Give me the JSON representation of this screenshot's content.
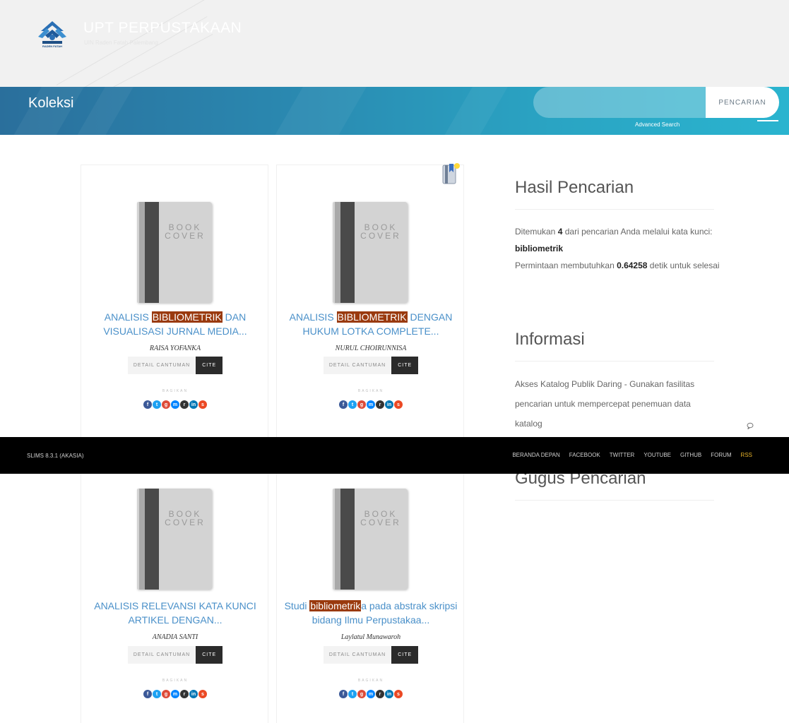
{
  "header": {
    "site_title": "UPT PERPUSTAKAAN",
    "site_subtitle": "UIN Raden Fatah Palembang",
    "logo_text": "RADEN FATAH"
  },
  "banner": {
    "page_title": "Koleksi",
    "search_placeholder": "",
    "search_button": "PENCARIAN",
    "advanced_search": "Advanced Search"
  },
  "books": [
    {
      "cover_text": "BOOK COVER",
      "title_pre": "ANALISIS ",
      "title_hl": "BIBLIOMETRIK",
      "title_post": " DAN VISUALISASI JURNAL MEDIA...",
      "author": "RAISA YOFANKA",
      "detail_label": "DETAIL CANTUMAN",
      "cite_label": "CITE",
      "share_label": "BAGIKAN"
    },
    {
      "cover_text": "BOOK COVER",
      "title_pre": "ANALISIS ",
      "title_hl": "BIBLIOMETRIK",
      "title_post": " DENGAN HUKUM LOTKA COMPLETE...",
      "author": "NURUL CHOIRUNNISA",
      "detail_label": "DETAIL CANTUMAN",
      "cite_label": "CITE",
      "share_label": "BAGIKAN"
    },
    {
      "cover_text": "BOOK COVER",
      "title_pre": "ANALISIS RELEVANSI KATA KUNCI ARTIKEL DENGAN...",
      "title_hl": "",
      "title_post": "",
      "author": "ANADIA SANTI",
      "detail_label": "DETAIL CANTUMAN",
      "cite_label": "CITE",
      "share_label": "BAGIKAN"
    },
    {
      "cover_text": "BOOK COVER",
      "title_pre": "Studi ",
      "title_hl": "bibliometrik",
      "title_post": "a pada abstrak skripsi bidang Ilmu Perpustakaa...",
      "author": "Laylatul Munawaroh",
      "detail_label": "DETAIL CANTUMAN",
      "cite_label": "CITE",
      "share_label": "BAGIKAN"
    }
  ],
  "share_icons": [
    {
      "name": "facebook-icon",
      "glyph": "f",
      "color": "#3b5998"
    },
    {
      "name": "twitter-icon",
      "glyph": "t",
      "color": "#1da1f2"
    },
    {
      "name": "google-plus-icon",
      "glyph": "g",
      "color": "#dd4b39"
    },
    {
      "name": "messenger-icon",
      "glyph": "m",
      "color": "#0084ff"
    },
    {
      "name": "reddit-icon",
      "glyph": "r",
      "color": "#333333"
    },
    {
      "name": "linkedin-icon",
      "glyph": "in",
      "color": "#0077b5"
    },
    {
      "name": "stumbleupon-icon",
      "glyph": "s",
      "color": "#eb4924"
    }
  ],
  "sidebar": {
    "results_heading": "Hasil Pencarian",
    "results_line1_a": "Ditemukan ",
    "results_count": "4",
    "results_line1_b": " dari pencarian Anda melalui kata kunci: ",
    "results_keyword": "bibliometrik",
    "results_line2_a": "Permintaan membutuhkan ",
    "results_time": "0.64258",
    "results_line2_b": " detik untuk selesai",
    "info_heading": "Informasi",
    "info_text": "Akses Katalog Publik Daring - Gunakan fasilitas pencarian untuk mempercepat penemuan data katalog",
    "cluster_heading": "Gugus Pencarian"
  },
  "footer": {
    "version": "SLIMS 8.3.1 (AKASIA)",
    "nav": [
      "BERANDA DEPAN",
      "FACEBOOK",
      "TWITTER",
      "YOUTUBE",
      "GITHUB",
      "FORUM",
      "RSS"
    ]
  },
  "colors": {
    "banner_start": "#2a6f9c",
    "banner_end": "#2ab4cf",
    "highlight": "#9a3a0e",
    "title_link": "#4a90c9",
    "rss": "#e8b32a"
  }
}
